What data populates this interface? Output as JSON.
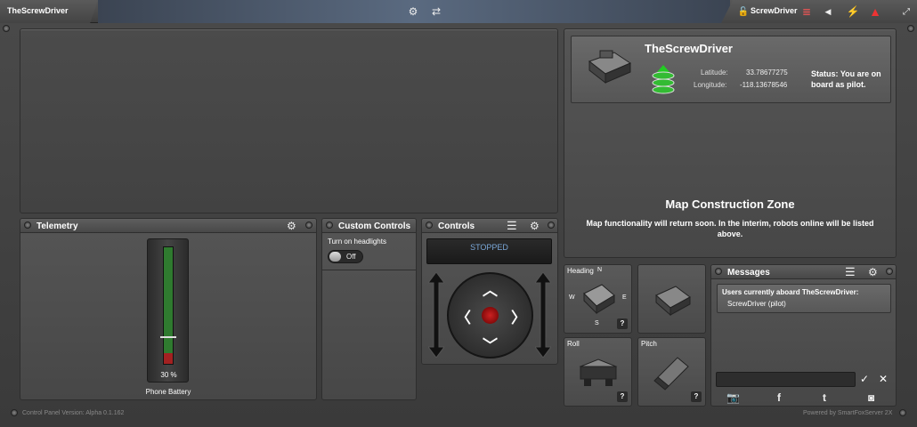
{
  "window": {
    "title": "TheScrewDriver",
    "user": "ScrewDriver"
  },
  "robot": {
    "name": "TheScrewDriver",
    "latitude_label": "Latitude:",
    "latitude": "33.78677275",
    "longitude_label": "Longitude:",
    "longitude": "-118.13678546",
    "status": "Status: You are on board as pilot."
  },
  "map": {
    "heading": "Map Construction Zone",
    "message": "Map functionality will return soon. In the interim, robots online will be listed above."
  },
  "telemetry": {
    "title": "Telemetry",
    "battery_percent": 30,
    "battery_text": "30 %",
    "battery_label": "Phone Battery"
  },
  "custom_controls": {
    "title": "Custom Controls",
    "headlights_label": "Turn on headlights",
    "toggle_state": "Off"
  },
  "controls": {
    "title": "Controls",
    "state": "STOPPED"
  },
  "tiles": {
    "heading": "Heading",
    "roll": "Roll",
    "pitch": "Pitch",
    "compass": {
      "n": "N",
      "e": "E",
      "s": "S",
      "w": "W"
    },
    "help": "?"
  },
  "messages": {
    "title": "Messages",
    "aboard_heading": "Users currently aboard TheScrewDriver:",
    "aboard_user": "ScrewDriver (pilot)",
    "input_value": "",
    "input_placeholder": ""
  },
  "footer": {
    "version": "Control Panel Version: Alpha 0.1.162",
    "powered": "Powered by SmartFoxServer 2X"
  },
  "colors": {
    "battery_green": "#2f7a2f",
    "battery_red": "#a32121",
    "stopped_text": "#7aa7d8"
  }
}
